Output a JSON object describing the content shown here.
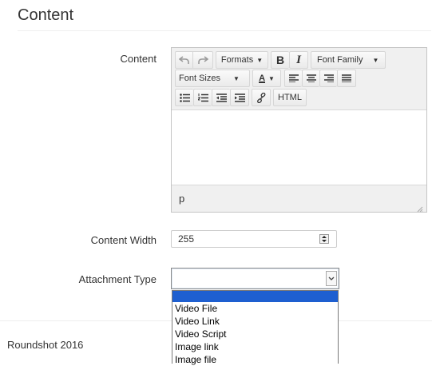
{
  "section": {
    "title": "Content"
  },
  "fields": {
    "content_label": "Content",
    "width_label": "Content Width",
    "width_value": "255",
    "attachment_label": "Attachment Type"
  },
  "editor": {
    "formats_label": "Formats",
    "bold_label": "B",
    "italic_label": "I",
    "font_family_label": "Font Family",
    "font_sizes_label": "Font Sizes",
    "text_color_label": "A",
    "html_label": "HTML",
    "status_path": "p"
  },
  "attachment": {
    "selected": "",
    "options": [
      "",
      "Video File",
      "Video Link",
      "Video Script",
      "Image link",
      "Image file"
    ]
  },
  "footer": {
    "text": "Roundshot 2016"
  },
  "colors": {
    "selection": "#1e5fd0"
  }
}
